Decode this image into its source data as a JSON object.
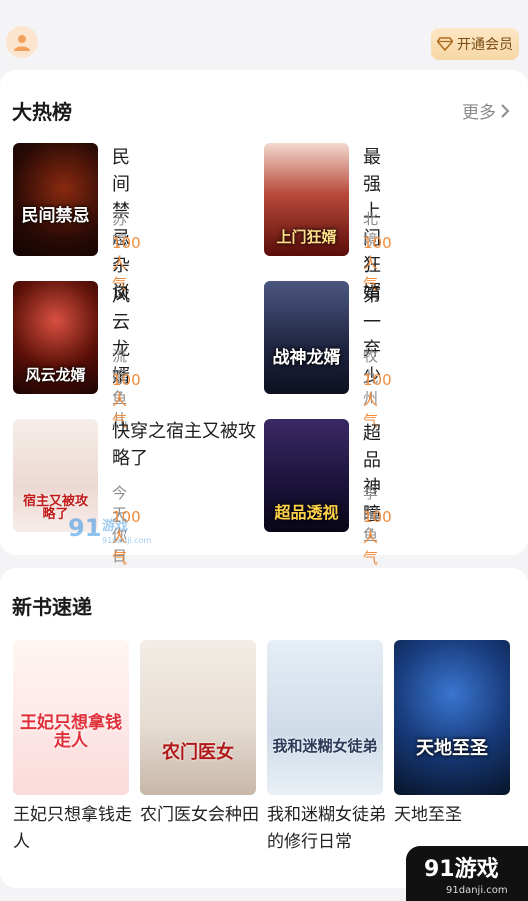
{
  "topbar": {
    "vip_label": "开通会员"
  },
  "hot": {
    "title": "大热榜",
    "more_label": "更多",
    "books": [
      {
        "title": "民间禁忌杂谈",
        "author": "苏皖",
        "popularity": "100人气",
        "cover_text": "民间禁忌"
      },
      {
        "title": "最强上门狂婿",
        "author": "北境",
        "popularity": "100人气",
        "cover_text": "上门狂婿"
      },
      {
        "title": "风云龙婿",
        "author": "流氓鱼儿",
        "popularity": "100人气",
        "cover_text": "风云龙婿"
      },
      {
        "title": "第一弃少",
        "author": "牧九州",
        "popularity": "100人气",
        "cover_text": "战神龙婿"
      },
      {
        "title": "快穿之宿主又被攻略了",
        "author": "今天你日万了吗",
        "popularity": "100人气",
        "cover_text": "宿主又被攻略了"
      },
      {
        "title": "超品神瞳",
        "author": "李闲鱼",
        "popularity": "100人气",
        "cover_text": "超品透视"
      }
    ]
  },
  "new_books": {
    "title": "新书速递",
    "books": [
      {
        "title": "王妃只想拿钱走人",
        "cover_text": "王妃只想拿钱走人"
      },
      {
        "title": "农门医女会种田",
        "cover_text": "农门医女"
      },
      {
        "title": "我和迷糊女徒弟的修行日常",
        "cover_text": "我和迷糊女徒弟"
      },
      {
        "title": "天地至圣",
        "cover_text": "天地至圣"
      }
    ]
  },
  "watermark": {
    "brand": "91游戏",
    "site": "91danji.com",
    "mini": "91"
  },
  "colors": {
    "accent": "#f08c3c",
    "vip_bg": "#f7d7a6",
    "card_bg": "#ffffff",
    "page_bg": "#f4f4f6"
  }
}
